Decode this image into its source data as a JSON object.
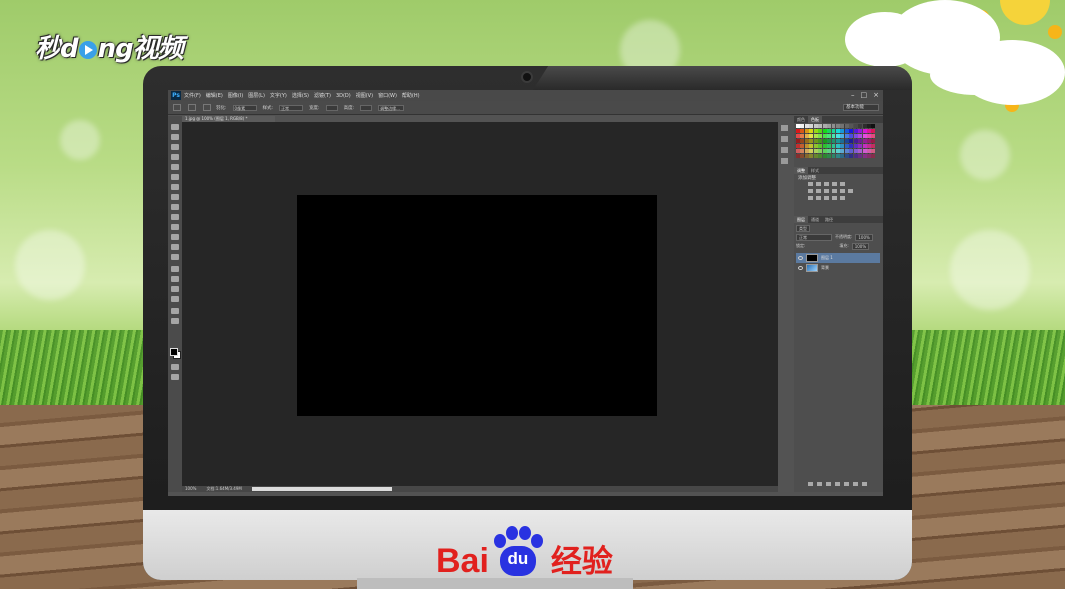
{
  "watermark": {
    "brand_text_1": "秒",
    "brand_text_2": "d",
    "brand_text_3": "ng视频"
  },
  "bezel": {
    "logo_bai": "Bai",
    "logo_du": "du",
    "logo_jingyan": "经验"
  },
  "photoshop": {
    "app_logo": "Ps",
    "menu": [
      "文件(F)",
      "编辑(E)",
      "图像(I)",
      "图层(L)",
      "文字(Y)",
      "选择(S)",
      "滤镜(T)",
      "3D(D)",
      "视图(V)",
      "窗口(W)",
      "帮助(H)"
    ],
    "window_controls": [
      "–",
      "□",
      "×"
    ],
    "options_bar": {
      "feather_label": "羽化:",
      "feather_value": "0像素",
      "style_label": "样式:",
      "style_value": "正常",
      "width_label": "宽度:",
      "height_label": "高度:",
      "refine_edge": "调整边缘...",
      "workspace": "基本功能"
    },
    "document_tab": "1.jpg @ 100% (图层 1, RGB/8) *",
    "status": {
      "zoom": "100%",
      "doc_info": "文档:1.64M/3.49M"
    },
    "panels": {
      "swatch_tabs": [
        "颜色",
        "色板"
      ],
      "adjust_tabs": [
        "调整",
        "样式"
      ],
      "adjust_title": "添加调整",
      "layer_tabs": [
        "图层",
        "通道",
        "路径"
      ],
      "kind_label": "类型",
      "blend_mode": "正常",
      "opacity_label": "不透明度:",
      "opacity_value": "100%",
      "lock_label": "锁定:",
      "fill_label": "填充:",
      "fill_value": "100%",
      "layers": [
        {
          "name": "图层 1",
          "selected": true
        },
        {
          "name": "背景",
          "selected": false
        }
      ]
    }
  },
  "colors": {
    "ps_bg": "#535353",
    "canvas": "#000000",
    "baidu_red": "#e1211e",
    "baidu_blue": "#2932e1"
  }
}
